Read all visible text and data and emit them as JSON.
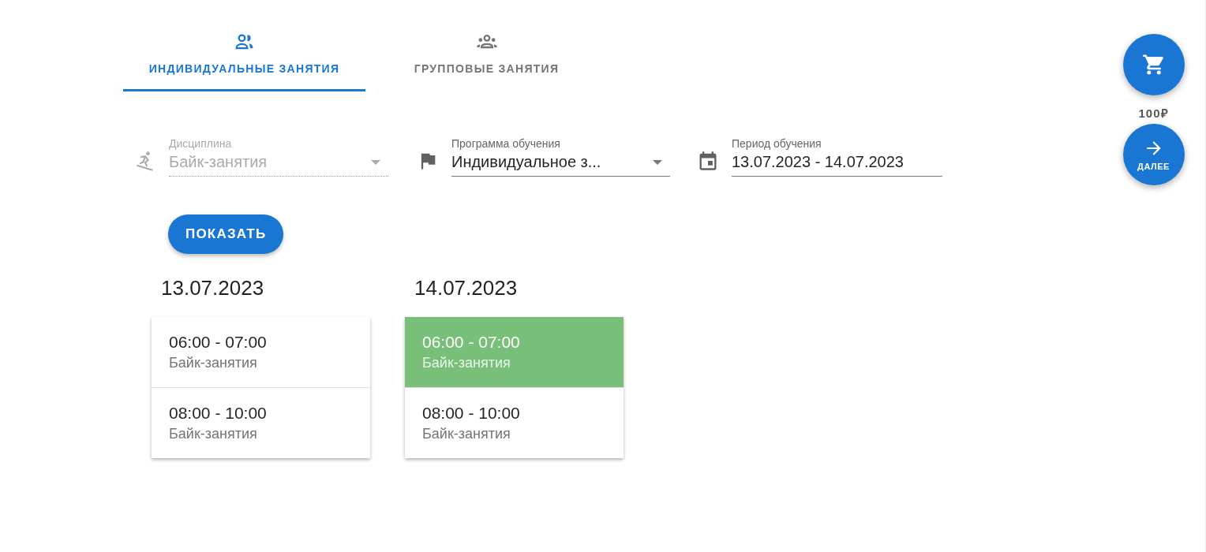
{
  "tabs": [
    {
      "label": "ИНДИВИДУАЛЬНЫЕ ЗАНЯТИЯ",
      "selected": true
    },
    {
      "label": "ГРУППОВЫЕ ЗАНЯТИЯ",
      "selected": false
    }
  ],
  "filters": [
    {
      "kind": "select",
      "label": "Дисциплина",
      "value": "Байк-занятия",
      "disabled": true
    },
    {
      "kind": "select",
      "label": "Программа обучения",
      "value": "Индивидуальное з...",
      "disabled": false
    },
    {
      "kind": "date",
      "label": "Период обучения",
      "value": "13.07.2023 - 14.07.2023",
      "disabled": false
    }
  ],
  "show_button": "ПОКАЗАТЬ",
  "days": [
    {
      "date": "13.07.2023",
      "slots": [
        {
          "time": "06:00 - 07:00",
          "name": "Байк-занятия",
          "selected": false
        },
        {
          "time": "08:00 - 10:00",
          "name": "Байк-занятия",
          "selected": false
        }
      ]
    },
    {
      "date": "14.07.2023",
      "slots": [
        {
          "time": "06:00 - 07:00",
          "name": "Байк-занятия",
          "selected": true
        },
        {
          "time": "08:00 - 10:00",
          "name": "Байк-занятия",
          "selected": false
        }
      ]
    }
  ],
  "cart": {
    "total": "100₽"
  },
  "next_button": "ДАЛЕЕ"
}
